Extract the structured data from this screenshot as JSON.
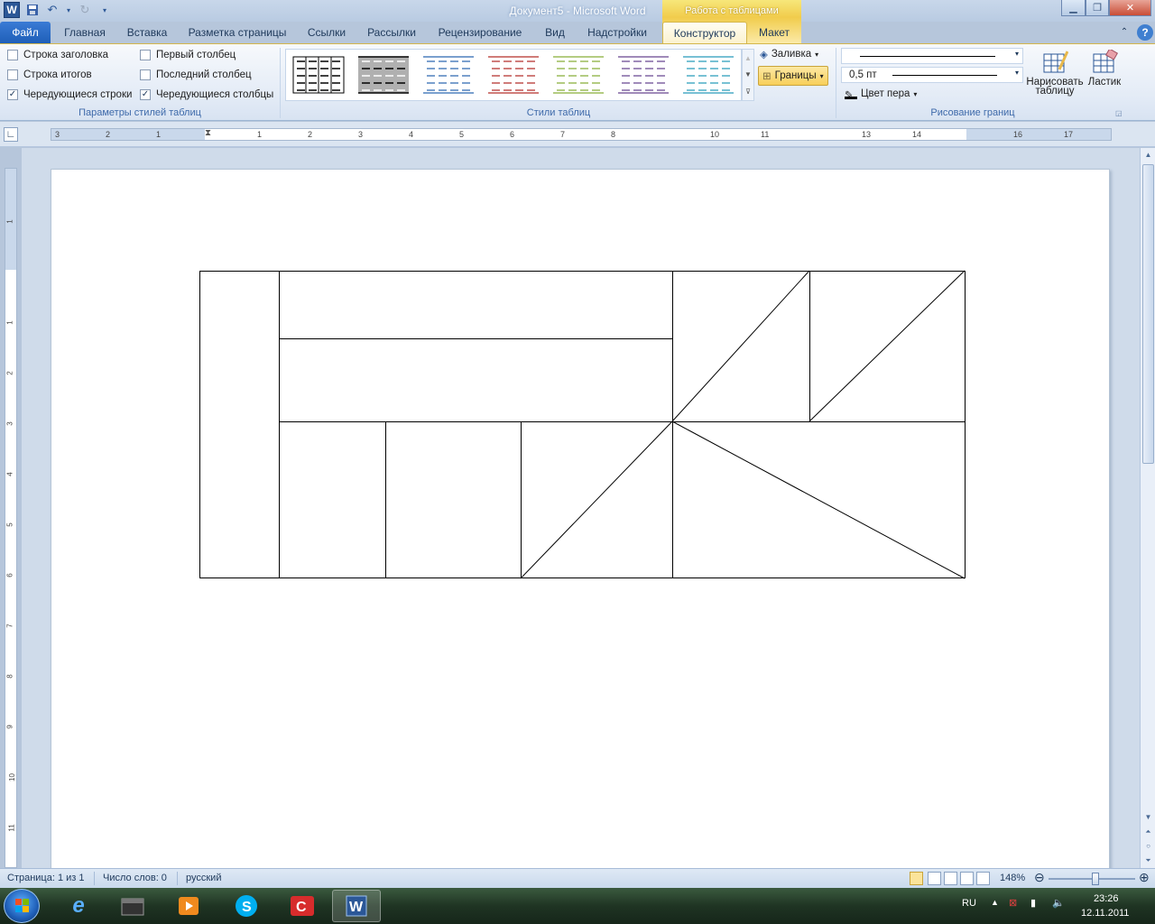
{
  "window": {
    "title": "Документ5 - Microsoft Word",
    "contextual_group": "Работа с таблицами"
  },
  "tabs": [
    "Файл",
    "Главная",
    "Вставка",
    "Разметка страницы",
    "Ссылки",
    "Рассылки",
    "Рецензирование",
    "Вид",
    "Надстройки",
    "Конструктор",
    "Макет"
  ],
  "ribbon": {
    "style_options": {
      "header_row": {
        "label": "Строка заголовка",
        "checked": false
      },
      "total_row": {
        "label": "Строка итогов",
        "checked": false
      },
      "banded_rows": {
        "label": "Чередующиеся строки",
        "checked": true
      },
      "first_column": {
        "label": "Первый столбец",
        "checked": false
      },
      "last_column": {
        "label": "Последний столбец",
        "checked": false
      },
      "banded_columns": {
        "label": "Чередующиеся столбцы",
        "checked": true
      },
      "group_label": "Параметры стилей таблиц"
    },
    "table_styles": {
      "group_label": "Стили таблиц",
      "thumb_colors": [
        "#000000",
        "#000000",
        "#4f81bd",
        "#c0504d",
        "#9bbb59",
        "#8064a2",
        "#4bacc6"
      ],
      "shading_label": "Заливка",
      "borders_label": "Границы"
    },
    "draw_borders": {
      "group_label": "Рисование границ",
      "pen_weight": "0,5 пт",
      "pen_color_label": "Цвет пера",
      "draw_table_label_1": "Нарисовать",
      "draw_table_label_2": "таблицу",
      "eraser_label": "Ластик"
    }
  },
  "ruler": {
    "h_numbers": [
      "3",
      "2",
      "1",
      "1",
      "2",
      "3",
      "4",
      "5",
      "6",
      "7",
      "8",
      "10",
      "11",
      "13",
      "14",
      "16",
      "17"
    ],
    "v_numbers": [
      "1",
      "1",
      "2",
      "3",
      "4",
      "5",
      "6",
      "7",
      "8",
      "9",
      "10",
      "11"
    ]
  },
  "statusbar": {
    "page": "Страница: 1 из 1",
    "words": "Число слов: 0",
    "language": "русский",
    "zoom": "148%"
  },
  "taskbar": {
    "lang": "RU",
    "time": "23:26",
    "date": "12.11.2011"
  }
}
